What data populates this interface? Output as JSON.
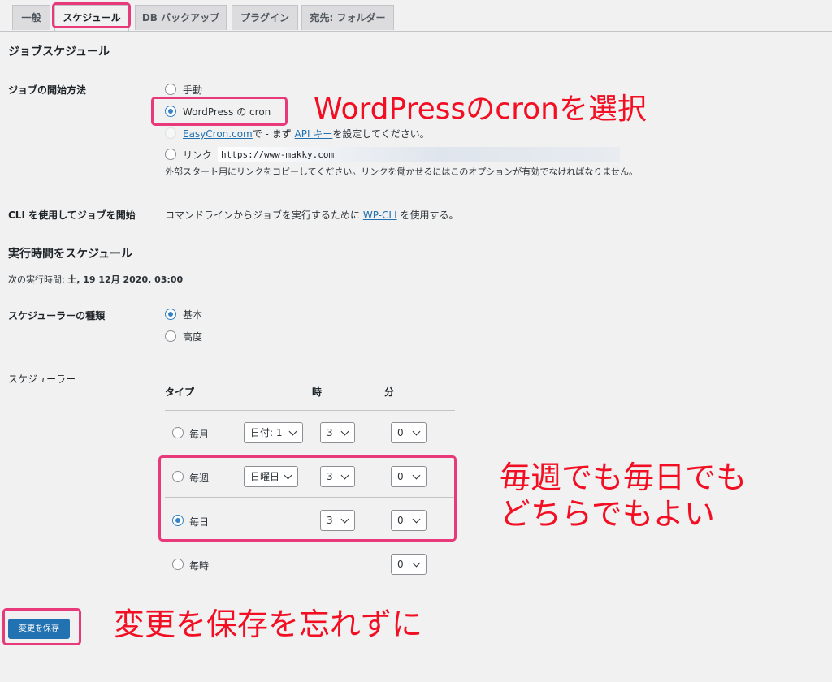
{
  "tabs": [
    {
      "label": "一般",
      "active": false
    },
    {
      "label": "スケジュール",
      "active": true
    },
    {
      "label": "DB バックアップ",
      "active": false
    },
    {
      "label": "プラグイン",
      "active": false
    },
    {
      "label": "宛先: フォルダー",
      "active": false
    }
  ],
  "job_schedule": {
    "heading": "ジョブスケジュール",
    "start_method_label": "ジョブの開始方法",
    "options": {
      "manual": "手動",
      "wpcron": "WordPress の cron",
      "easycron_link": "EasyCron.com",
      "easycron_mid": "で - まず",
      "api_key_link": "API キー",
      "easycron_end": "を設定してください。",
      "link": "リンク"
    },
    "selected": "wpcron",
    "link_url": "https://www-makky.com",
    "link_help": "外部スタート用にリンクをコピーしてください。リンクを働かせるにはこのオプションが有効でなければなりません。",
    "cli_label": "CLI を使用してジョブを開始",
    "cli_text_before": "コマンドラインからジョブを実行するために",
    "cli_link": "WP-CLI",
    "cli_text_after": "を使用する。"
  },
  "run_schedule": {
    "heading": "実行時間をスケジュール",
    "next_run_label": "次の実行時間:",
    "next_run_value": "土, 19 12月 2020, 03:00",
    "scheduler_type_label": "スケジューラーの種類",
    "type_basic": "基本",
    "type_advanced": "高度",
    "scheduler_label": "スケジューラー",
    "columns": {
      "type": "タイプ",
      "hour": "時",
      "minute": "分"
    },
    "rows": [
      {
        "label": "毎月",
        "day": "日付: 1",
        "hour": "3",
        "minute": "0",
        "checked": false
      },
      {
        "label": "毎週",
        "day": "日曜日",
        "hour": "3",
        "minute": "0",
        "checked": false
      },
      {
        "label": "毎日",
        "hour": "3",
        "minute": "0",
        "checked": true
      },
      {
        "label": "毎時",
        "minute": "0",
        "checked": false
      }
    ]
  },
  "save_button": "変更を保存",
  "annotations": {
    "select_cron": "WordPressのcronを選択",
    "weekly_daily_1": "毎週でも毎日でも",
    "weekly_daily_2": "どちらでもよい",
    "dont_forget_save": "変更を保存を忘れずに"
  },
  "colors": {
    "accent": "#2271b1",
    "annotation": "#f20f23",
    "highlight": "#e8397a"
  }
}
